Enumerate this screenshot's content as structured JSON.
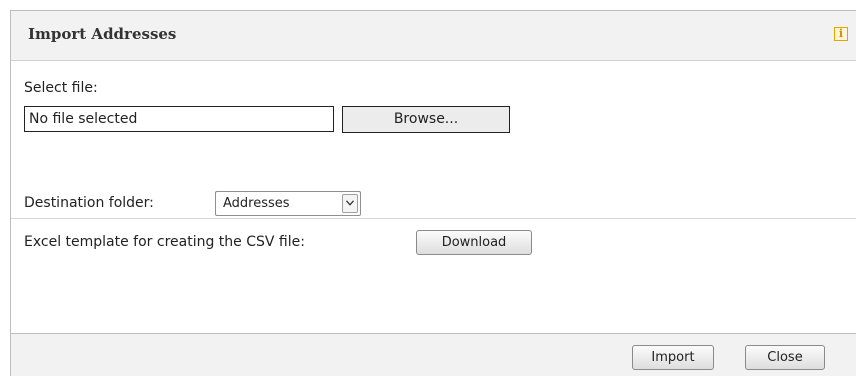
{
  "dialog": {
    "title": "Import Addresses",
    "info_icon": "info-icon",
    "info_glyph": "i"
  },
  "select_file": {
    "label": "Select file:",
    "value": "No file selected",
    "browse_label": "Browse..."
  },
  "destination": {
    "label": "Destination folder:",
    "selected": "Addresses",
    "arrow_icon": "chevron-down-icon"
  },
  "template": {
    "label": "Excel template for creating the CSV file:",
    "download_label": "Download"
  },
  "footer": {
    "import_label": "Import",
    "close_label": "Close"
  }
}
